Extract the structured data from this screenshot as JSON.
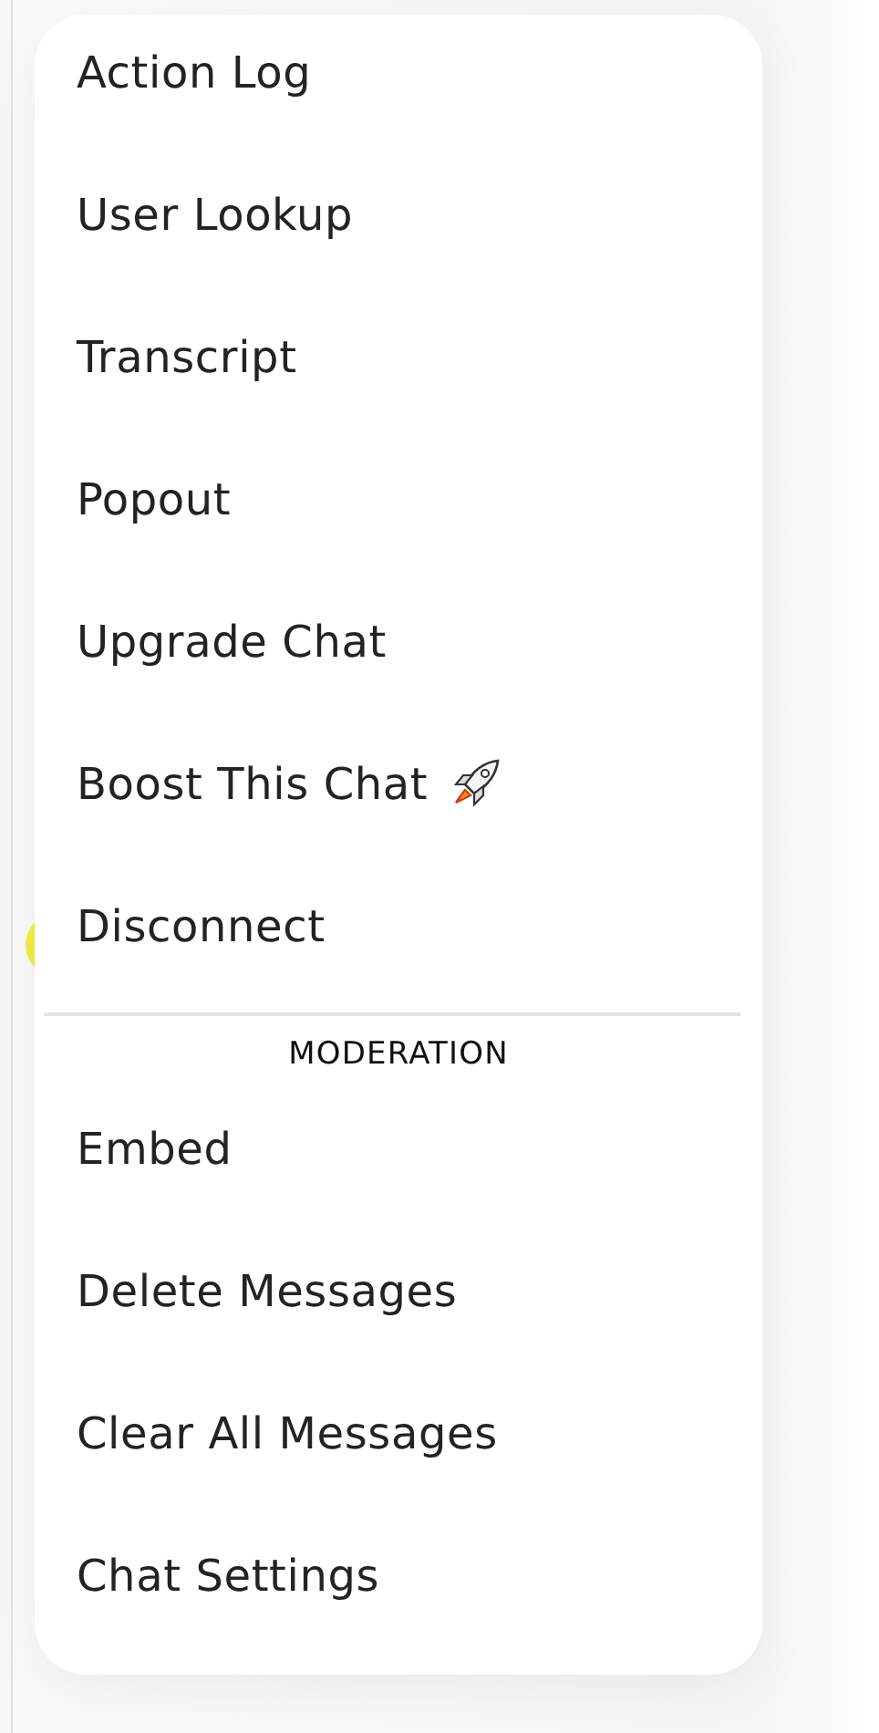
{
  "menu": {
    "items": [
      {
        "label": "Action Log"
      },
      {
        "label": "User Lookup"
      },
      {
        "label": "Transcript"
      },
      {
        "label": "Popout"
      },
      {
        "label": "Upgrade Chat"
      },
      {
        "label": "Boost This Chat",
        "kind": "rocket"
      },
      {
        "label": "Disconnect"
      }
    ],
    "sections": [
      {
        "heading": "MODERATION",
        "items": [
          {
            "label": "Embed"
          },
          {
            "label": "Delete Messages"
          },
          {
            "label": "Clear All Messages"
          },
          {
            "label": "Chat Settings"
          }
        ]
      }
    ]
  }
}
